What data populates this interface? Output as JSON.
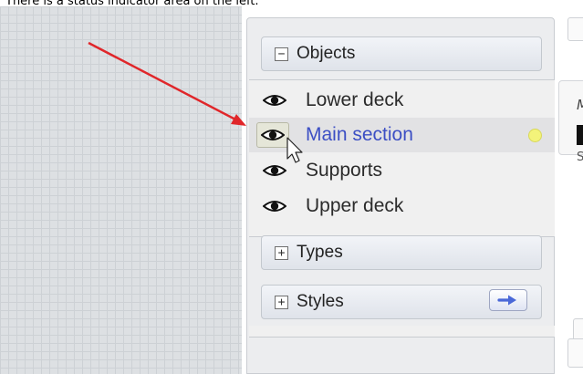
{
  "caption": "There is a status indicator area on the left.",
  "sections": {
    "objects": {
      "label": "Objects",
      "toggle": "−",
      "expanded": true
    },
    "types": {
      "label": "Types",
      "toggle": "+",
      "expanded": false
    },
    "styles": {
      "label": "Styles",
      "toggle": "+",
      "expanded": false
    }
  },
  "objects_list": [
    {
      "label": "Lower deck",
      "visibility_icon": "eye-icon",
      "selected": false
    },
    {
      "label": "Main section",
      "visibility_icon": "eye-icon",
      "selected": true,
      "status_color": "#f3f37a"
    },
    {
      "label": "Supports",
      "visibility_icon": "eye-icon",
      "selected": false
    },
    {
      "label": "Upper deck",
      "visibility_icon": "eye-icon",
      "selected": false
    }
  ],
  "right_panel": {
    "text1": "M",
    "text2": "S"
  },
  "colors": {
    "annotation_arrow": "#e0262a",
    "selected_label": "#3c4fc4",
    "styles_arrow": "#4a68d8"
  }
}
